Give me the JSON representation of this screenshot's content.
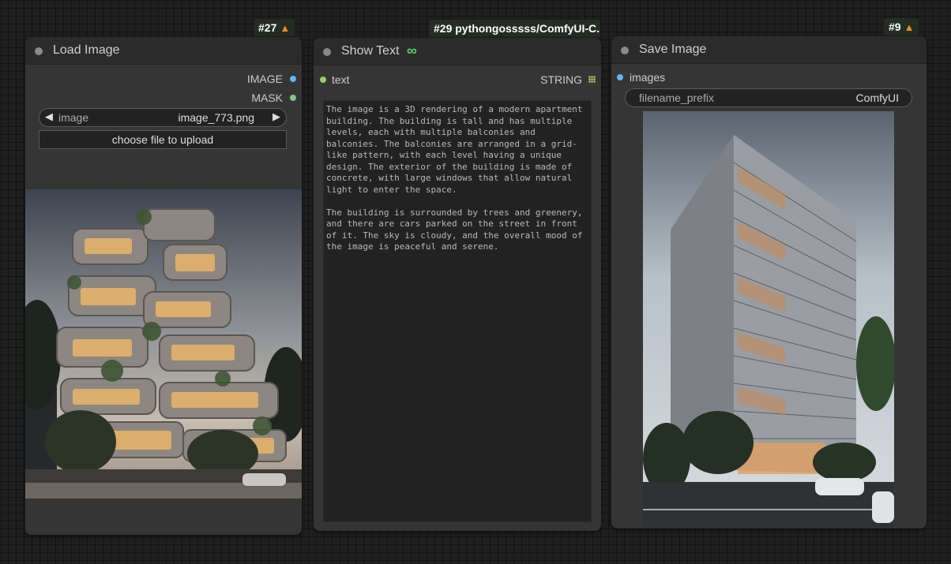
{
  "nodes": {
    "load_image": {
      "badge": "#27",
      "badge_icon": "fox-icon",
      "title": "Load Image",
      "outputs": [
        {
          "label": "IMAGE",
          "color": "#64b5f6"
        },
        {
          "label": "MASK",
          "color": "#81c784"
        }
      ],
      "image_widget": {
        "label": "image",
        "value": "image_773.png"
      },
      "upload_label": "choose file to upload"
    },
    "show_text": {
      "badge": "#29 pythongosssss/ComfyUI-C..",
      "title": "Show Text",
      "title_icon": "pysssss-snake-icon",
      "input": {
        "label": "text",
        "color": "#9ccc65"
      },
      "output": {
        "label": "STRING",
        "color": "#9ccc65"
      },
      "text": "The image is a 3D rendering of a modern apartment building. The building is tall and has multiple levels, each with multiple balconies and balconies. The balconies are arranged in a grid-like pattern, with each level having a unique design. The exterior of the building is made of concrete, with large windows that allow natural light to enter the space.\n\nThe building is surrounded by trees and greenery, and there are cars parked on the street in front of it. The sky is cloudy, and the overall mood of the image is peaceful and serene."
    },
    "save_image": {
      "badge": "#9",
      "badge_icon": "fox-icon",
      "title": "Save Image",
      "input": {
        "label": "images",
        "color": "#64b5f6"
      },
      "filename_widget": {
        "label": "filename_prefix",
        "value": "ComfyUI"
      }
    }
  },
  "colors": {
    "canvas": "#1f1f1f",
    "node_body": "#353535",
    "node_title": "#2b2b2b",
    "badge_bg": "#232d23",
    "image_port": "#64b5f6",
    "mask_port": "#81c784",
    "string_port": "#9ccc65"
  }
}
